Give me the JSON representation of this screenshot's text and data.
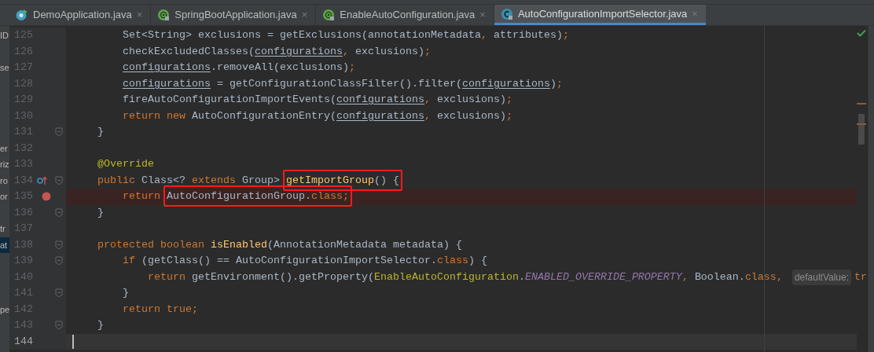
{
  "tabs": [
    {
      "label": "DemoApplication.java",
      "kind": "run",
      "selected": false
    },
    {
      "label": "SpringBootApplication.java",
      "kind": "annotation",
      "selected": false
    },
    {
      "label": "EnableAutoConfiguration.java",
      "kind": "annotation",
      "selected": false
    },
    {
      "label": "AutoConfigurationImportSelector.java",
      "kind": "class",
      "selected": true
    }
  ],
  "close_glyph": "×",
  "lines": [
    {
      "number": "125",
      "side": "ID",
      "fold": false,
      "breakpoint": false,
      "current": false,
      "segments": [
        {
          "t": "        Set<String> exclusions = getExclusions(annotationMetadata",
          "kind": "plain"
        },
        {
          "t": ", ",
          "kind": "punct"
        },
        {
          "t": "attributes)",
          "kind": "plain"
        },
        {
          "t": ";",
          "kind": "punct"
        }
      ]
    },
    {
      "number": "126",
      "fold": false,
      "breakpoint": false,
      "current": false,
      "segments": [
        {
          "t": "        checkExcludedClasses(",
          "kind": "plain"
        },
        {
          "t": "configurations",
          "kind": "var"
        },
        {
          "t": ", ",
          "kind": "punct"
        },
        {
          "t": "exclusions)",
          "kind": "plain"
        },
        {
          "t": ";",
          "kind": "punct"
        }
      ]
    },
    {
      "number": "127",
      "side": "se",
      "fold": false,
      "breakpoint": false,
      "current": false,
      "segments": [
        {
          "t": "        configurations",
          "kind": "var"
        },
        {
          "t": ".removeAll(exclusions)",
          "kind": "plain"
        },
        {
          "t": ";",
          "kind": "punct"
        }
      ]
    },
    {
      "number": "128",
      "fold": false,
      "breakpoint": false,
      "current": false,
      "segments": [
        {
          "t": "        configurations",
          "kind": "var"
        },
        {
          "t": " = getConfigurationClassFilter().filter(",
          "kind": "plain"
        },
        {
          "t": "configurations",
          "kind": "var"
        },
        {
          "t": ")",
          "kind": "plain"
        },
        {
          "t": ";",
          "kind": "punct"
        }
      ]
    },
    {
      "number": "129",
      "fold": false,
      "breakpoint": false,
      "current": false,
      "segments": [
        {
          "t": "        fireAutoConfigurationImportEvents(",
          "kind": "plain"
        },
        {
          "t": "configurations",
          "kind": "var"
        },
        {
          "t": ", ",
          "kind": "punct"
        },
        {
          "t": "exclusions)",
          "kind": "plain"
        },
        {
          "t": ";",
          "kind": "punct"
        }
      ]
    },
    {
      "number": "130",
      "fold": false,
      "breakpoint": false,
      "current": false,
      "segments": [
        {
          "t": "        return new ",
          "kind": "kw"
        },
        {
          "t": "AutoConfigurationEntry(",
          "kind": "plain"
        },
        {
          "t": "configurations",
          "kind": "var"
        },
        {
          "t": ", ",
          "kind": "punct"
        },
        {
          "t": "exclusions)",
          "kind": "plain"
        },
        {
          "t": ";",
          "kind": "punct"
        }
      ]
    },
    {
      "number": "131",
      "fold": true,
      "breakpoint": false,
      "current": false,
      "segments": [
        {
          "t": "    }",
          "kind": "plain"
        }
      ]
    },
    {
      "number": "132",
      "side": "er",
      "fold": false,
      "breakpoint": false,
      "current": false
    },
    {
      "number": "133",
      "side": "riz",
      "fold": false,
      "breakpoint": false,
      "current": false,
      "segments": [
        {
          "t": "    @Override",
          "kind": "anno"
        }
      ]
    },
    {
      "number": "134",
      "side": "ro",
      "override": true,
      "fold": true,
      "breakpoint": false,
      "current": false,
      "segments": [
        {
          "t": "    public ",
          "kind": "kw"
        },
        {
          "t": "Class<? ",
          "kind": "plain"
        },
        {
          "t": "extends ",
          "kind": "kw"
        },
        {
          "t": "Group> ",
          "kind": "plain"
        },
        {
          "t": "getImportGroup",
          "kind": "decl",
          "boxed": true
        },
        {
          "t": "() {",
          "kind": "plain",
          "boxed": true
        }
      ]
    },
    {
      "number": "135",
      "side": "or",
      "fold": false,
      "breakpoint": true,
      "current": false,
      "segments": [
        {
          "t": "        return ",
          "kind": "kw"
        },
        {
          "t": "AutoConfigurationGroup.",
          "kind": "plain",
          "boxed": true
        },
        {
          "t": "class;",
          "kind": "kw",
          "boxed": true
        }
      ]
    },
    {
      "number": "136",
      "fold": true,
      "breakpoint": false,
      "current": false,
      "segments": [
        {
          "t": "    }",
          "kind": "plain"
        }
      ]
    },
    {
      "number": "137",
      "side": "tr",
      "fold": false,
      "breakpoint": false,
      "current": false
    },
    {
      "number": "138",
      "side": "at",
      "side_selected": true,
      "fold": true,
      "breakpoint": false,
      "current": false,
      "segments": [
        {
          "t": "    protected boolean ",
          "kind": "kw"
        },
        {
          "t": "isEnabled",
          "kind": "decl"
        },
        {
          "t": "(AnnotationMetadata metadata) {",
          "kind": "plain"
        }
      ]
    },
    {
      "number": "139",
      "fold": true,
      "breakpoint": false,
      "current": false,
      "segments": [
        {
          "t": "        if ",
          "kind": "kw"
        },
        {
          "t": "(getClass() == AutoConfigurationImportSelector.",
          "kind": "plain"
        },
        {
          "t": "class",
          "kind": "kw"
        },
        {
          "t": ") {",
          "kind": "plain"
        }
      ]
    },
    {
      "number": "140",
      "fold": false,
      "breakpoint": false,
      "current": false,
      "segments": [
        {
          "t": "            return ",
          "kind": "kw"
        },
        {
          "t": "getEnvironment().getProperty(",
          "kind": "plain"
        },
        {
          "t": "EnableAutoConfiguration",
          "kind": "cls"
        },
        {
          "t": ".",
          "kind": "plain"
        },
        {
          "t": "ENABLED_OVERRIDE_PROPERTY",
          "kind": "field"
        },
        {
          "t": ", ",
          "kind": "punct"
        },
        {
          "t": "Boolean.",
          "kind": "plain"
        },
        {
          "t": "class",
          "kind": "kw"
        },
        {
          "t": ", ",
          "kind": "punct"
        },
        {
          "t": "defaultValue:",
          "kind": "hint"
        },
        {
          "t": "tr",
          "kind": "kw"
        }
      ]
    },
    {
      "number": "141",
      "fold": true,
      "breakpoint": false,
      "current": false,
      "segments": [
        {
          "t": "        }",
          "kind": "plain"
        }
      ]
    },
    {
      "number": "142",
      "side": "pe",
      "fold": false,
      "breakpoint": false,
      "current": false,
      "segments": [
        {
          "t": "        return true;",
          "kind": "kw"
        }
      ]
    },
    {
      "number": "143",
      "fold": true,
      "breakpoint": false,
      "current": false,
      "segments": [
        {
          "t": "    }",
          "kind": "plain"
        }
      ]
    },
    {
      "number": "144",
      "fold": false,
      "breakpoint": false,
      "current": true
    }
  ]
}
